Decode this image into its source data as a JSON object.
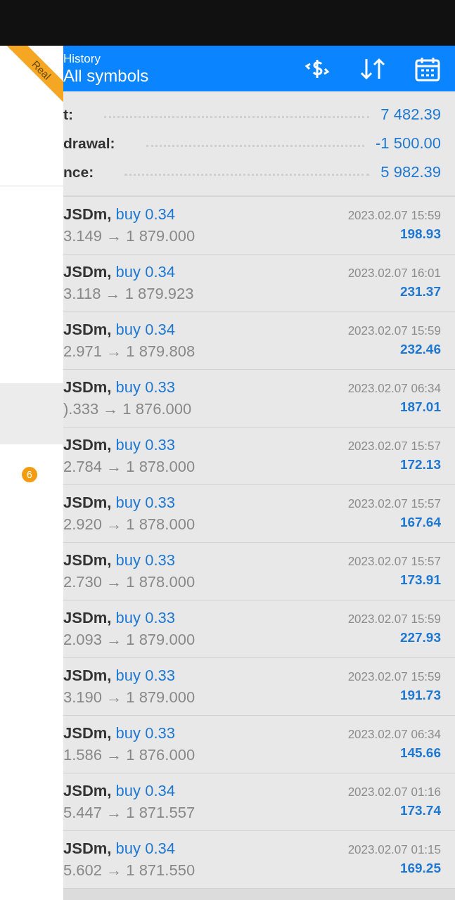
{
  "drawer": {
    "ribbon": "Real",
    "badge": "6"
  },
  "header": {
    "subtitle": "History",
    "title": "All symbols"
  },
  "summary": [
    {
      "label": "t:",
      "value": "7 482.39"
    },
    {
      "label": "drawal:",
      "value": "-1 500.00"
    },
    {
      "label": "nce:",
      "value": "5 982.39"
    }
  ],
  "trades": [
    {
      "symbol": "JSDm,",
      "side": "buy 0.34",
      "prices": "3.149 → 1 879.000",
      "time": "2023.02.07 15:59",
      "profit": "198.93"
    },
    {
      "symbol": "JSDm,",
      "side": "buy 0.34",
      "prices": "3.118 → 1 879.923",
      "time": "2023.02.07 16:01",
      "profit": "231.37"
    },
    {
      "symbol": "JSDm,",
      "side": "buy 0.34",
      "prices": "2.971 → 1 879.808",
      "time": "2023.02.07 15:59",
      "profit": "232.46"
    },
    {
      "symbol": "JSDm,",
      "side": "buy 0.33",
      "prices": ").333 → 1 876.000",
      "time": "2023.02.07 06:34",
      "profit": "187.01"
    },
    {
      "symbol": "JSDm,",
      "side": "buy 0.33",
      "prices": "2.784 → 1 878.000",
      "time": "2023.02.07 15:57",
      "profit": "172.13"
    },
    {
      "symbol": "JSDm,",
      "side": "buy 0.33",
      "prices": "2.920 → 1 878.000",
      "time": "2023.02.07 15:57",
      "profit": "167.64"
    },
    {
      "symbol": "JSDm,",
      "side": "buy 0.33",
      "prices": "2.730 → 1 878.000",
      "time": "2023.02.07 15:57",
      "profit": "173.91"
    },
    {
      "symbol": "JSDm,",
      "side": "buy 0.33",
      "prices": "2.093 → 1 879.000",
      "time": "2023.02.07 15:59",
      "profit": "227.93"
    },
    {
      "symbol": "JSDm,",
      "side": "buy 0.33",
      "prices": "3.190 → 1 879.000",
      "time": "2023.02.07 15:59",
      "profit": "191.73"
    },
    {
      "symbol": "JSDm,",
      "side": "buy 0.33",
      "prices": "1.586 → 1 876.000",
      "time": "2023.02.07 06:34",
      "profit": "145.66"
    },
    {
      "symbol": "JSDm,",
      "side": "buy 0.34",
      "prices": "5.447 → 1 871.557",
      "time": "2023.02.07 01:16",
      "profit": "173.74"
    },
    {
      "symbol": "JSDm,",
      "side": "buy 0.34",
      "prices": "5.602 → 1 871.550",
      "time": "2023.02.07 01:15",
      "profit": "169.25"
    }
  ]
}
